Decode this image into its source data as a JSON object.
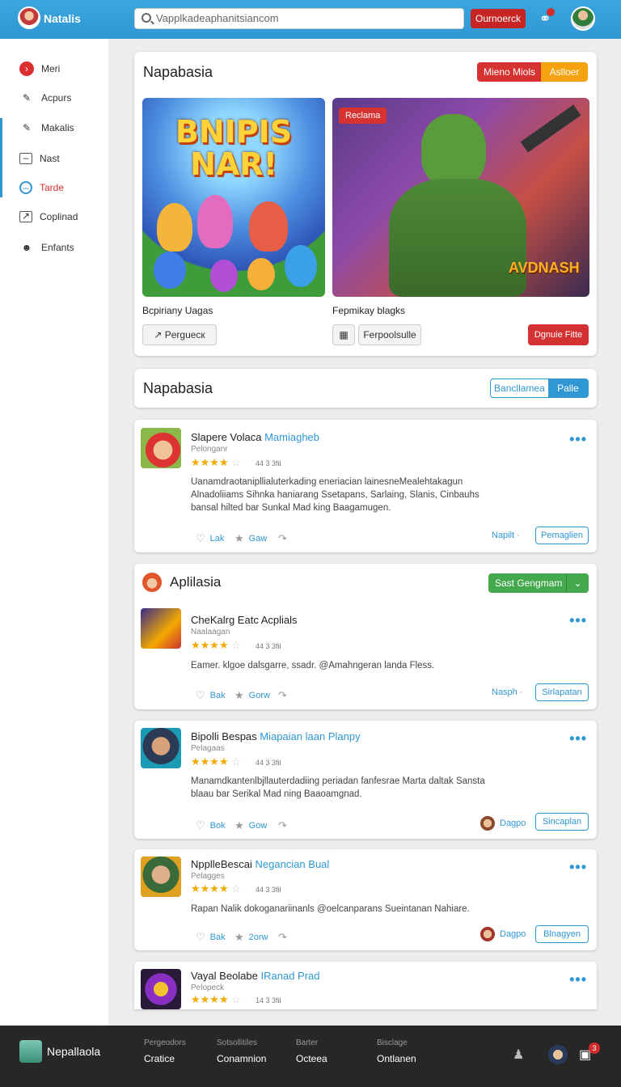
{
  "topbar": {
    "title": "Natalis",
    "search_value": "Vapplkadeaphanitsiancom",
    "button": "Ournoerck"
  },
  "sidebar": {
    "items": [
      {
        "label": "Meri",
        "icon": "play-icon"
      },
      {
        "label": "Acpurs",
        "icon": "pencil-icon"
      },
      {
        "label": "Makalis",
        "icon": "pencil-icon"
      },
      {
        "label": "Nast",
        "icon": "minus-box-icon"
      },
      {
        "label": "Tarde",
        "icon": "circle-icon"
      },
      {
        "label": "Coplinad",
        "icon": "chart-box-icon"
      },
      {
        "label": "Enfants",
        "icon": "people-icon"
      }
    ]
  },
  "featured": {
    "title": "Napabasia",
    "pill_red": "Mieno Miols",
    "pill_orange": "Aslloer",
    "game1": {
      "art_text": "BNIPIS NAR!",
      "caption": "Bcpiriany Uagas",
      "button": "Perguecк"
    },
    "game2": {
      "badge": "Reclama",
      "art_text": "AVDNASH",
      "caption": "Fepmikay blagks",
      "button": "Ferpoolsulle",
      "cta": "Dgnuie Fitte"
    }
  },
  "feed_header": {
    "title": "Napabasia",
    "seg_left": "Bancllamea",
    "seg_right": "Palle"
  },
  "posts": [
    {
      "title": "Slapere Volaca",
      "title_hl": "Mamiagheb",
      "sub": "Pelonganr",
      "rating": "44 3 3fil",
      "stars": 4,
      "body": "Uanamdraotanipllialuterkading eneriacian  lainesneMealehtakagun Alnadoliiams Sihnka haniarang Ssetapans, Sarlaing, Slanis, Cinbauhs bansal hilted bar Sunkal Mad king Baagamugen.",
      "like": "Lak",
      "share": "Gaw",
      "link": "Napilt ·",
      "button": "Pemaglien"
    },
    {
      "title": "CheKalrg Eatc Acplials",
      "title_hl": "",
      "sub": "Naalaagan",
      "rating": "44 3 3fil",
      "stars": 4,
      "body": "Eamer. klgoe dalsgarre, ssadr. @Amahngeran landa Fless.",
      "like": "Bak",
      "share": "Gorw",
      "link": "Nasph ·",
      "button": "Sirlapatan"
    },
    {
      "title": "Bipolli Bespas",
      "title_hl": "Miapaian laan Planpy",
      "sub": "Pelagaas",
      "rating": "44 3 3fil",
      "stars": 4,
      "body": "Manamdkantenlbjllauterdadiing periadan fanfesrae Marta daltak Sansta blaau bar Serikal Mad ning Baaoamgnad.",
      "like": "Bok",
      "share": "Gow",
      "link": "Dagpo",
      "button": "Sincaplan"
    },
    {
      "title": "NpplleBescai",
      "title_hl": "Negancian Bual",
      "sub": "Pelagges",
      "rating": "44 3 3fil",
      "stars": 4,
      "body": "Rapan Nalik dokoganariinanls @oelcanparans Sueintanan Nahiare.",
      "like": "Bak",
      "share": "2orw",
      "link": "Dagpo",
      "button": "Blnagyen"
    },
    {
      "title": "Vayal Beolabe",
      "title_hl": "IRanad Prad",
      "sub": "Pelopeck",
      "rating": "14 3 3fil",
      "stars": 4
    }
  ],
  "section2": {
    "title": "Aplilasia",
    "button": "Sast Gengmam"
  },
  "footer": {
    "title": "Nepallaola",
    "cols": [
      {
        "top": "Pergeodors",
        "bottom": "Cratice"
      },
      {
        "top": "Sotsollitiles",
        "bottom": "Conamnion"
      },
      {
        "top": "Barter",
        "bottom": "Octeea"
      },
      {
        "top": "Bisclage",
        "bottom": "Ontlanen"
      }
    ],
    "badge": "3"
  },
  "colors": {
    "accent": "#2f97d3",
    "danger": "#d43232",
    "success": "#44a84c",
    "star": "#f2a900"
  }
}
